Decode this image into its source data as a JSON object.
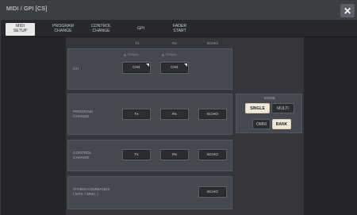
{
  "window": {
    "title": "MIDI / GPI [CS]"
  },
  "tabs": [
    {
      "label": "MIDI\nSETUP",
      "active": true
    },
    {
      "label": "PROGRAM\nCHANGE",
      "active": false
    },
    {
      "label": "CONTROL\nCHANGE",
      "active": false
    },
    {
      "label": "GPI",
      "active": false
    },
    {
      "label": "FADER\nSTART",
      "active": false
    }
  ],
  "columns": {
    "tx": "Tx",
    "rx": "Rx",
    "echo": "ECHO"
  },
  "sections": {
    "ch": {
      "label": "CH",
      "tx_indicator": "SIGNAL",
      "rx_indicator": "SIGNAL",
      "tx_value": "CH1",
      "rx_value": "CH1"
    },
    "program_change": {
      "label": "PROGRAM\nCHANGE",
      "tx": "Tx",
      "rx": "Rx",
      "echo": "ECHO"
    },
    "control_change": {
      "label": "CONTROL\nCHANGE",
      "tx": "Tx",
      "rx": "Rx",
      "echo": "ECHO"
    },
    "other_commands": {
      "label": "OTHER COMMANDS\n( MTC / MMC )",
      "echo": "ECHO"
    }
  },
  "mode": {
    "label": "MODE",
    "single": "SINGLE",
    "multi": "MULTI",
    "omni": "OMNI",
    "bank": "BANK",
    "active": [
      "SINGLE",
      "BANK"
    ]
  },
  "icons": {
    "close": "close-icon"
  },
  "colors": {
    "accent_on": "#f0e8d8",
    "panel": "#45484e",
    "background": "#2b2d31"
  }
}
